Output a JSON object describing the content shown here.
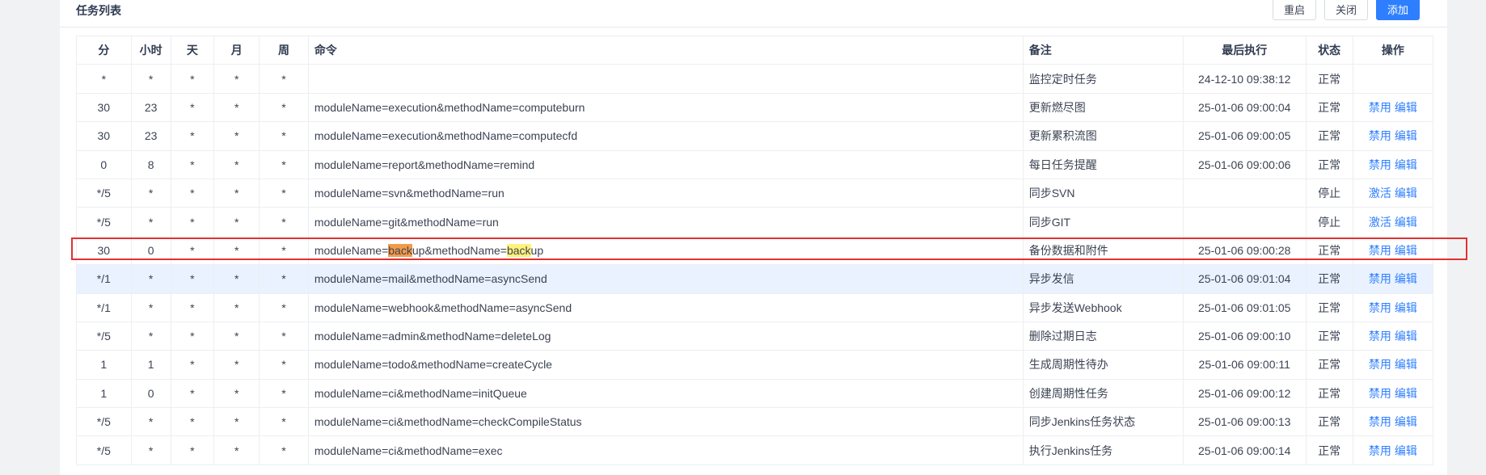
{
  "panel": {
    "title": "任务列表",
    "buttons": {
      "restart": "重启",
      "close": "关闭",
      "add": "添加"
    }
  },
  "columns": [
    "分",
    "小时",
    "天",
    "月",
    "周",
    "命令",
    "备注",
    "最后执行",
    "状态",
    "操作"
  ],
  "highlight_term": "back",
  "rows": [
    {
      "min": "*",
      "hour": "*",
      "day": "*",
      "month": "*",
      "week": "*",
      "command": "",
      "note": "监控定时任务",
      "last_run": "24-12-10 09:38:12",
      "status": "正常",
      "ops": []
    },
    {
      "min": "30",
      "hour": "23",
      "day": "*",
      "month": "*",
      "week": "*",
      "command": "moduleName=execution&methodName=computeburn",
      "note": "更新燃尽图",
      "last_run": "25-01-06 09:00:04",
      "status": "正常",
      "ops": [
        "禁用",
        "编辑"
      ]
    },
    {
      "min": "30",
      "hour": "23",
      "day": "*",
      "month": "*",
      "week": "*",
      "command": "moduleName=execution&methodName=computecfd",
      "note": "更新累积流图",
      "last_run": "25-01-06 09:00:05",
      "status": "正常",
      "ops": [
        "禁用",
        "编辑"
      ]
    },
    {
      "min": "0",
      "hour": "8",
      "day": "*",
      "month": "*",
      "week": "*",
      "command": "moduleName=report&methodName=remind",
      "note": "每日任务提醒",
      "last_run": "25-01-06 09:00:06",
      "status": "正常",
      "ops": [
        "禁用",
        "编辑"
      ]
    },
    {
      "min": "*/5",
      "hour": "*",
      "day": "*",
      "month": "*",
      "week": "*",
      "command": "moduleName=svn&methodName=run",
      "note": "同步SVN",
      "last_run": "",
      "status": "停止",
      "ops": [
        "激活",
        "编辑"
      ]
    },
    {
      "min": "*/5",
      "hour": "*",
      "day": "*",
      "month": "*",
      "week": "*",
      "command": "moduleName=git&methodName=run",
      "note": "同步GIT",
      "last_run": "",
      "status": "停止",
      "ops": [
        "激活",
        "编辑"
      ]
    },
    {
      "min": "30",
      "hour": "0",
      "day": "*",
      "month": "*",
      "week": "*",
      "command": "moduleName=backup&methodName=backup",
      "note": "备份数据和附件",
      "last_run": "25-01-06 09:00:28",
      "status": "正常",
      "ops": [
        "禁用",
        "编辑"
      ],
      "search_match": true
    },
    {
      "min": "*/1",
      "hour": "*",
      "day": "*",
      "month": "*",
      "week": "*",
      "command": "moduleName=mail&methodName=asyncSend",
      "note": "异步发信",
      "last_run": "25-01-06 09:01:04",
      "status": "正常",
      "ops": [
        "禁用",
        "编辑"
      ],
      "hovered": true
    },
    {
      "min": "*/1",
      "hour": "*",
      "day": "*",
      "month": "*",
      "week": "*",
      "command": "moduleName=webhook&methodName=asyncSend",
      "note": "异步发送Webhook",
      "last_run": "25-01-06 09:01:05",
      "status": "正常",
      "ops": [
        "禁用",
        "编辑"
      ]
    },
    {
      "min": "*/5",
      "hour": "*",
      "day": "*",
      "month": "*",
      "week": "*",
      "command": "moduleName=admin&methodName=deleteLog",
      "note": "删除过期日志",
      "last_run": "25-01-06 09:00:10",
      "status": "正常",
      "ops": [
        "禁用",
        "编辑"
      ]
    },
    {
      "min": "1",
      "hour": "1",
      "day": "*",
      "month": "*",
      "week": "*",
      "command": "moduleName=todo&methodName=createCycle",
      "note": "生成周期性待办",
      "last_run": "25-01-06 09:00:11",
      "status": "正常",
      "ops": [
        "禁用",
        "编辑"
      ]
    },
    {
      "min": "1",
      "hour": "0",
      "day": "*",
      "month": "*",
      "week": "*",
      "command": "moduleName=ci&methodName=initQueue",
      "note": "创建周期性任务",
      "last_run": "25-01-06 09:00:12",
      "status": "正常",
      "ops": [
        "禁用",
        "编辑"
      ]
    },
    {
      "min": "*/5",
      "hour": "*",
      "day": "*",
      "month": "*",
      "week": "*",
      "command": "moduleName=ci&methodName=checkCompileStatus",
      "note": "同步Jenkins任务状态",
      "last_run": "25-01-06 09:00:13",
      "status": "正常",
      "ops": [
        "禁用",
        "编辑"
      ]
    },
    {
      "min": "*/5",
      "hour": "*",
      "day": "*",
      "month": "*",
      "week": "*",
      "command": "moduleName=ci&methodName=exec",
      "note": "执行Jenkins任务",
      "last_run": "25-01-06 09:00:14",
      "status": "正常",
      "ops": [
        "禁用",
        "编辑"
      ]
    }
  ],
  "colors": {
    "primary": "#2e7fff",
    "hover_row": "#e9f2fe",
    "match_highlight_current": "#f29b4a",
    "match_highlight_other": "#fff27a",
    "selection_box": "#e23131"
  }
}
